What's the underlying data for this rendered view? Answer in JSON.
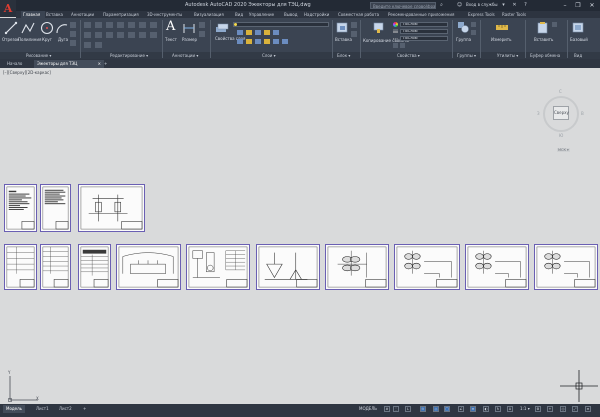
{
  "app": {
    "logo": "A",
    "title": "Autodesk AutoCAD 2020   Эжекторы для ТЭЦ.dwg"
  },
  "title_bar": {
    "search_placeholder": "Введите ключевое слово/фразу",
    "signin": "Вход в службы",
    "icons": [
      "binoculars-icon",
      "user-icon",
      "cart-icon",
      "exchange-icon",
      "help-icon"
    ],
    "window_buttons": {
      "minimize": "–",
      "restore": "❐",
      "close": "✕"
    }
  },
  "ribbon_tabs": [
    "Главная",
    "Вставка",
    "Аннотации",
    "Параметризация",
    "3D-инструменты",
    "Визуализация",
    "Вид",
    "Управление",
    "Вывод",
    "Надстройки",
    "Совместная работа",
    "Рекомендованные приложения",
    "Express Tools",
    "Raster Tools"
  ],
  "ribbon": {
    "draw": {
      "tools": [
        "Отрезок",
        "Полилиния",
        "Круг",
        "Дуга"
      ],
      "panel": "Рисование ▾"
    },
    "modify": {
      "panel": "Редактирование ▾"
    },
    "annotation": {
      "tools": [
        "Текст",
        "Размер"
      ],
      "panel": "Аннотации ▾"
    },
    "layers": {
      "tool": "Свойства слоя",
      "panel": "Слои ▾"
    },
    "block": {
      "tool": "Вставка",
      "panel": "Блок ▾"
    },
    "properties": {
      "tool": "Копирование свойств",
      "values": [
        "ПоСлою",
        "ПоСлою",
        "ПоСлою"
      ],
      "panel": "Свойства ▾"
    },
    "groups": {
      "tool": "Группа",
      "panel": "Группы ▾"
    },
    "utilities": {
      "tool": "Измерить",
      "panel": "Утилиты ▾"
    },
    "clipboard": {
      "tool": "Вставить",
      "panel": "Буфер обмена"
    },
    "view": {
      "tool": "Базовый",
      "panel": "Вид"
    }
  },
  "doc_tabs": {
    "start": "Начало",
    "file": "Эжекторы для ТЭЦ",
    "close": "×",
    "add": "+"
  },
  "viewport": {
    "label": "[–][Сверху][2D-каркас]",
    "viewcube": {
      "face": "Сверху",
      "n": "С",
      "s": "Ю",
      "w": "З",
      "e": "В",
      "wcs": "МСК ▾"
    },
    "ucs": {
      "x": "X",
      "y": "Y"
    }
  },
  "layout_tabs": [
    "Модель",
    "Лист1",
    "Лист2"
  ],
  "layout_add": "+",
  "status_bar": {
    "model": "МОДЕЛЬ",
    "scale": "1:1 ▾",
    "icons": [
      "grid-icon",
      "snap-icon",
      "ortho-icon",
      "polar-icon",
      "isodraft-icon",
      "osnap-icon",
      "otrack-icon",
      "lineweight-icon",
      "transparency-icon",
      "annotation-scale-icon",
      "workspace-icon",
      "settings-icon",
      "fullscreen-icon",
      "customize-icon"
    ]
  }
}
